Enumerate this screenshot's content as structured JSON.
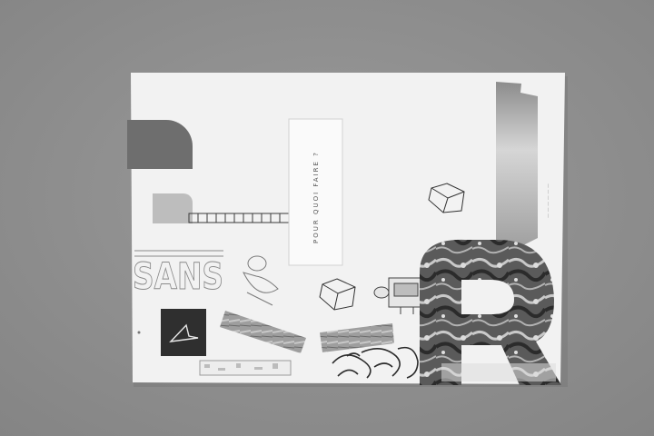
{
  "photo": {
    "subject": "collage poster on grey table",
    "vertical_text": "POUR QUOI FAIRE ?",
    "vertical_text_small": "—  —  —  —  —  —",
    "colors": {
      "table": "#8f8f8f",
      "paper": "#f2f2f2",
      "grey_tab": "#6e6e6e",
      "dark_square": "#2f2f2f",
      "marble_dark": "#3a3a3a",
      "marble_light": "#bdbdbd",
      "ink": "#2a2a2a"
    }
  }
}
